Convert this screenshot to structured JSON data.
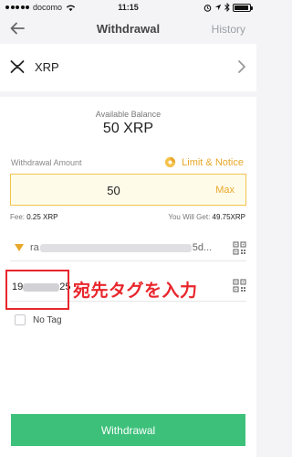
{
  "status_bar": {
    "carrier": "docomo",
    "time": "11:15",
    "battery_percent": 95
  },
  "nav": {
    "title": "Withdrawal",
    "history_label": "History"
  },
  "coin": {
    "name": "XRP"
  },
  "balance": {
    "label": "Available Balance",
    "value": "50 XRP"
  },
  "amount": {
    "label": "Withdrawal Amount",
    "limit_label": "Limit & Notice",
    "value": "50",
    "max_label": "Max"
  },
  "fee": {
    "label": "Fee:",
    "value": "0.25 XRP",
    "get_label": "You Will Get:",
    "get_value": "49.75XRP"
  },
  "address": {
    "prefix": "ra",
    "suffix": "5d..."
  },
  "tag": {
    "prefix": "19",
    "suffix": "25"
  },
  "annotation": {
    "text": "宛先タグを入力"
  },
  "no_tag": {
    "label": "No Tag"
  },
  "submit": {
    "label": "Withdrawal"
  },
  "colors": {
    "accent": "#e8a82a",
    "primary_button": "#3cc07a",
    "annotation": "#e8262c"
  }
}
